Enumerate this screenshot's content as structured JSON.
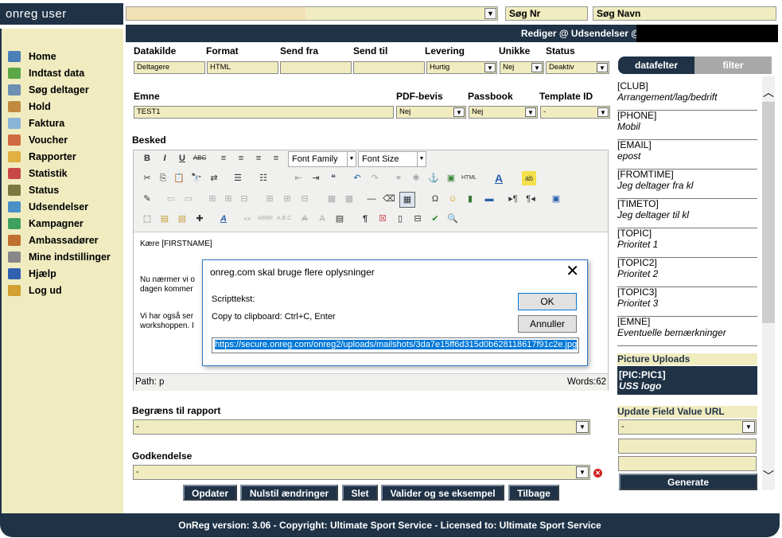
{
  "app": {
    "brand": "onreg user"
  },
  "topbar": {
    "search_select_value": "",
    "search_nr_placeholder": "Søg Nr",
    "search_name_placeholder": "Søg Navn"
  },
  "sidebar": {
    "items": [
      {
        "label": "Home",
        "icon": "home-icon",
        "color": "#4a7fb8"
      },
      {
        "label": "Indtast data",
        "icon": "add-data-icon",
        "color": "#5aa848"
      },
      {
        "label": "Søg deltager",
        "icon": "search-user-icon",
        "color": "#6c8fb3"
      },
      {
        "label": "Hold",
        "icon": "team-icon",
        "color": "#c08a40"
      },
      {
        "label": "Faktura",
        "icon": "invoice-icon",
        "color": "#8ab4d8"
      },
      {
        "label": "Voucher",
        "icon": "voucher-icon",
        "color": "#d06a40"
      },
      {
        "label": "Rapporter",
        "icon": "reports-icon",
        "color": "#e0b040"
      },
      {
        "label": "Statistik",
        "icon": "statistics-icon",
        "color": "#c84848"
      },
      {
        "label": "Status",
        "icon": "status-icon",
        "color": "#7a7a40"
      },
      {
        "label": "Udsendelser",
        "icon": "mail-icon",
        "color": "#4a90c8"
      },
      {
        "label": "Kampagner",
        "icon": "campaign-icon",
        "color": "#40a060"
      },
      {
        "label": "Ambassadører",
        "icon": "ambassador-icon",
        "color": "#c07030"
      },
      {
        "label": "Mine indstillinger",
        "icon": "settings-icon",
        "color": "#888888"
      },
      {
        "label": "Hjælp",
        "icon": "help-icon",
        "color": "#3060b0"
      },
      {
        "label": "Log ud",
        "icon": "logout-icon",
        "color": "#d0a030"
      }
    ]
  },
  "header": {
    "title": "Rediger @ Udsendelser @"
  },
  "form": {
    "datakilde": {
      "label": "Datakilde",
      "value": "Deltagere"
    },
    "format": {
      "label": "Format",
      "value": "HTML"
    },
    "send_fra": {
      "label": "Send fra",
      "value": ""
    },
    "send_til": {
      "label": "Send til",
      "value": ""
    },
    "levering": {
      "label": "Levering",
      "value": "Hurtig"
    },
    "unikke": {
      "label": "Unikke",
      "value": "Nej"
    },
    "status": {
      "label": "Status",
      "value": "Deaktiv"
    },
    "emne": {
      "label": "Emne",
      "value": "TEST1"
    },
    "pdf_bevis": {
      "label": "PDF-bevis",
      "value": "Nej"
    },
    "passbook": {
      "label": "Passbook",
      "value": "Nej"
    },
    "template_id": {
      "label": "Template ID",
      "value": "-"
    },
    "besked": {
      "label": "Besked"
    }
  },
  "editor": {
    "font_family": "Font Family",
    "font_size": "Font Size",
    "body_lines": [
      "Kære [FIRSTNAME]",
      "Nu nærmer vi o",
      "dagen kommer",
      "Vi har også ser",
      "workshoppen. I"
    ],
    "path": "Path: p",
    "words": "Words:62"
  },
  "dialog": {
    "title": "onreg.com skal bruge flere oplysninger",
    "script_label": "Scripttekst:",
    "hint": "Copy to clipboard: Ctrl+C, Enter",
    "ok": "OK",
    "cancel": "Annuller",
    "url": "https://secure.onreg.com/onreg2/uploads/mailshots/3da7e15ff6d315d0b628118617f91c2e.jpg"
  },
  "report": {
    "label": "Begræns til rapport",
    "value": "-"
  },
  "approval": {
    "label": "Godkendelse",
    "value": "-"
  },
  "buttons": {
    "update": "Opdater",
    "reset": "Nulstil ændringer",
    "delete": "Slet",
    "validate": "Valider og se eksempel",
    "back": "Tilbage"
  },
  "rightpanel": {
    "tab_fields": "datafelter",
    "tab_filter": "filter",
    "fields": [
      {
        "code": "[CLUB]",
        "desc": "Arrangement/lag/bedrift"
      },
      {
        "code": "[PHONE]",
        "desc": "Mobil"
      },
      {
        "code": "[EMAIL]",
        "desc": "epost"
      },
      {
        "code": "[FROMTIME]",
        "desc": "Jeg deltager fra kl"
      },
      {
        "code": "[TIMETO]",
        "desc": "Jeg deltager til kl"
      },
      {
        "code": "[TOPIC]",
        "desc": "Prioritet 1"
      },
      {
        "code": "[TOPIC2]",
        "desc": "Prioritet 2"
      },
      {
        "code": "[TOPIC3]",
        "desc": "Prioritet 3"
      },
      {
        "code": "[EMNE]",
        "desc": "Eventuelle bemærkninger"
      }
    ],
    "picture_uploads": "Picture Uploads",
    "pic_code": "[PIC:PIC1]",
    "pic_desc": "USS logo",
    "update_url_label": "Update Field Value URL",
    "update_url_value": "-",
    "generate": "Generate"
  },
  "footer": {
    "text": "OnReg version: 3.06 - Copyright: Ultimate Sport Service - Licensed to: Ultimate Sport Service"
  },
  "colors": {
    "navy": "#1f3246",
    "cream": "#f0ecc0",
    "selection": "#0078d7"
  }
}
